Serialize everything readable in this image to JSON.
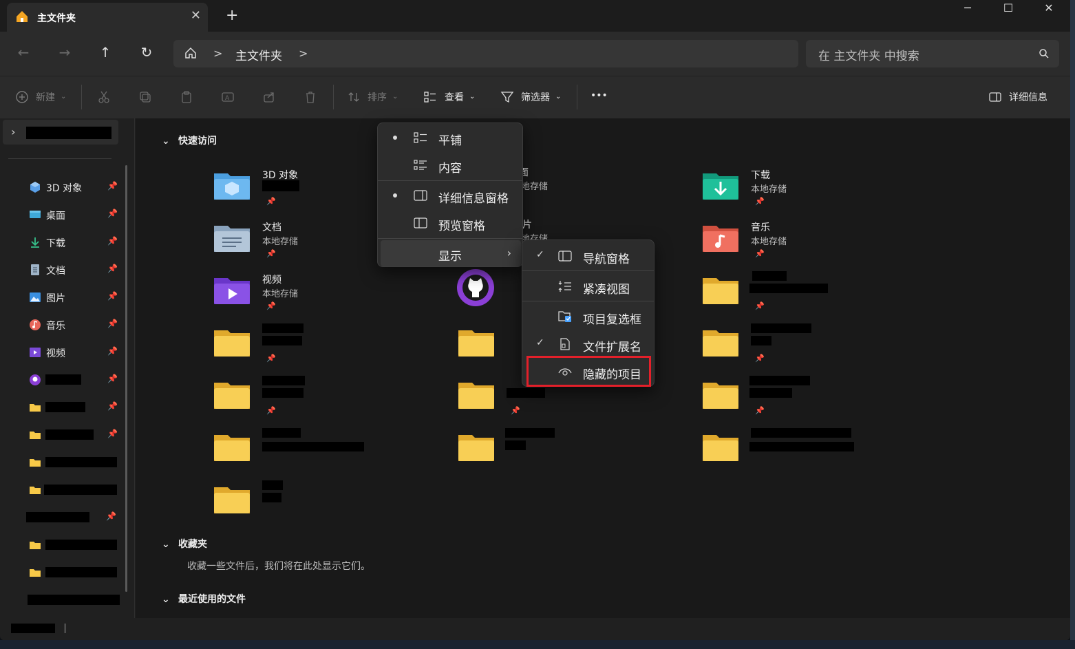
{
  "window": {
    "tab_title": "主文件夹",
    "tab_close": "✕",
    "new_tab": "+",
    "minimize": "─",
    "maximize": "☐",
    "close": "✕"
  },
  "nav": {
    "back": "←",
    "forward": "→",
    "up": "↑",
    "refresh": "↻",
    "breadcrumb": "主文件夹",
    "separator": ">",
    "search_placeholder": "在 主文件夹 中搜索"
  },
  "toolbar": {
    "new_label": "新建",
    "sort_label": "排序",
    "view_label": "查看",
    "filter_label": "筛选器",
    "more_label": "•••",
    "details_label": "详细信息"
  },
  "sidebar": {
    "items": [
      {
        "label": "3D 对象",
        "pin": "📌"
      },
      {
        "label": "桌面",
        "pin": "📌"
      },
      {
        "label": "下载",
        "pin": "📌"
      },
      {
        "label": "文档",
        "pin": "📌"
      },
      {
        "label": "图片",
        "pin": "📌"
      },
      {
        "label": "音乐",
        "pin": "📌"
      },
      {
        "label": "视频",
        "pin": "📌"
      }
    ]
  },
  "main": {
    "quick_access": "快速访问",
    "favorites": "收藏夹",
    "favorites_note": "收藏一些文件后，我们将在此处显示它们。",
    "recent": "最近使用的文件",
    "items": [
      {
        "name": "3D 对象",
        "sub": ""
      },
      {
        "name": "下载",
        "sub": "本地存储"
      },
      {
        "name": "文档",
        "sub": "本地存储"
      },
      {
        "name": "音乐",
        "sub": "本地存储"
      },
      {
        "name": "视频",
        "sub": "本地存储"
      }
    ],
    "partial": {
      "desktop_tail": "面",
      "desktop_sub": "地存储",
      "pictures_tail": "片",
      "pictures_sub": "地存储"
    }
  },
  "view_menu": {
    "items": [
      {
        "label": "平铺"
      },
      {
        "label": "内容"
      },
      {
        "label": "详细信息窗格"
      },
      {
        "label": "预览窗格"
      },
      {
        "label": "显示"
      }
    ]
  },
  "show_submenu": {
    "items": [
      {
        "label": "导航窗格",
        "check": "✓"
      },
      {
        "label": "紧凑视图"
      },
      {
        "label": "项目复选框"
      },
      {
        "label": "文件扩展名",
        "check": "✓"
      },
      {
        "label": "隐藏的项目"
      }
    ]
  },
  "colors": {
    "highlight": "#e3202a",
    "accent": "#4aa3ff"
  }
}
